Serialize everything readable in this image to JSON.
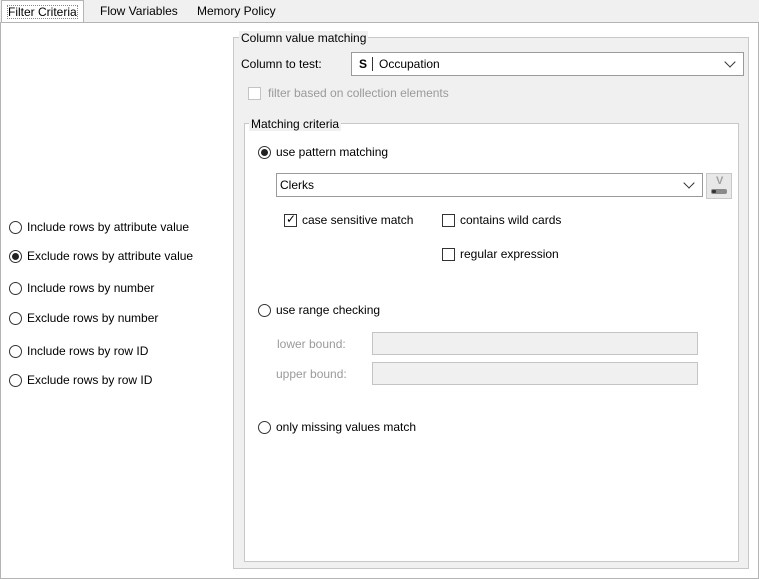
{
  "tabs": [
    "Filter Criteria",
    "Flow Variables",
    "Memory Policy"
  ],
  "mode_options": [
    {
      "label": "Include rows by attribute value",
      "selected": false
    },
    {
      "label": "Exclude rows by attribute value",
      "selected": true
    },
    {
      "label": "Include rows by number",
      "selected": false
    },
    {
      "label": "Exclude rows by number",
      "selected": false
    },
    {
      "label": "Include rows by row ID",
      "selected": false
    },
    {
      "label": "Exclude rows by row ID",
      "selected": false
    }
  ],
  "column_matching": {
    "title": "Column value matching",
    "column_label": "Column to test:",
    "column_type": "S",
    "column_value": "Occupation",
    "collection_label": "filter based on collection elements",
    "collection_checked": false
  },
  "matching_criteria": {
    "title": "Matching criteria",
    "pattern_label": "use pattern matching",
    "pattern_selected": true,
    "pattern_value": "Clerks",
    "flow_variable_icon": "V",
    "case_sensitive_label": "case sensitive match",
    "case_sensitive_checked": true,
    "wildcards_label": "contains wild cards",
    "wildcards_checked": false,
    "regex_label": "regular expression",
    "regex_checked": false,
    "range_label": "use range checking",
    "range_selected": false,
    "lower_label": "lower bound:",
    "lower_value": "",
    "upper_label": "upper bound:",
    "upper_value": "",
    "missing_label": "only missing values match",
    "missing_selected": false
  },
  "icons": {
    "radio": "radio-button-icon",
    "checkbox": "checkbox-icon",
    "dropdown": "chevron-down-icon",
    "flow_variable": "flow-variable-icon"
  }
}
